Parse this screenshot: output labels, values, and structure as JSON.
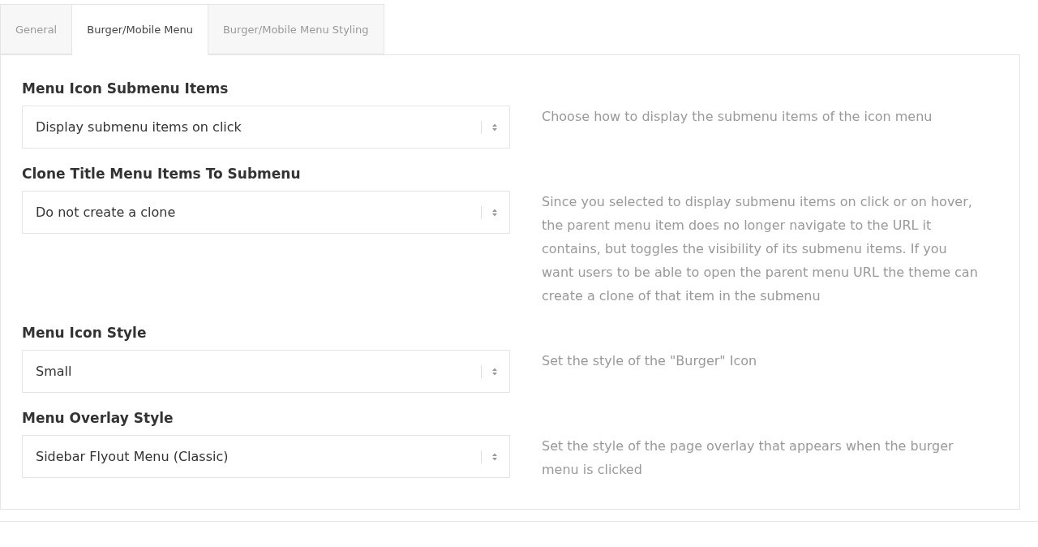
{
  "tabs": [
    {
      "label": "General",
      "selected": false
    },
    {
      "label": "Burger/Mobile Menu",
      "selected": true
    },
    {
      "label": "Burger/Mobile Menu Styling",
      "selected": false
    }
  ],
  "settings": [
    {
      "label": "Menu Icon Submenu Items",
      "value": "Display submenu items on click",
      "description": "Choose how to display the submenu items of the icon menu"
    },
    {
      "label": "Clone Title Menu Items To Submenu",
      "value": "Do not create a clone",
      "description": "Since you selected to display submenu items on click or on hover, the parent menu item does no longer navigate to the URL it contains, but toggles the visibility of its submenu items. If you want users to be able to open the parent menu URL the theme can create a clone of that item in the submenu"
    },
    {
      "label": "Menu Icon Style",
      "value": "Small",
      "description": "Set the style of the \"Burger\" Icon"
    },
    {
      "label": "Menu Overlay Style",
      "value": "Sidebar Flyout Menu (Classic)",
      "description": "Set the style of the page overlay that appears when the burger menu is clicked"
    }
  ]
}
